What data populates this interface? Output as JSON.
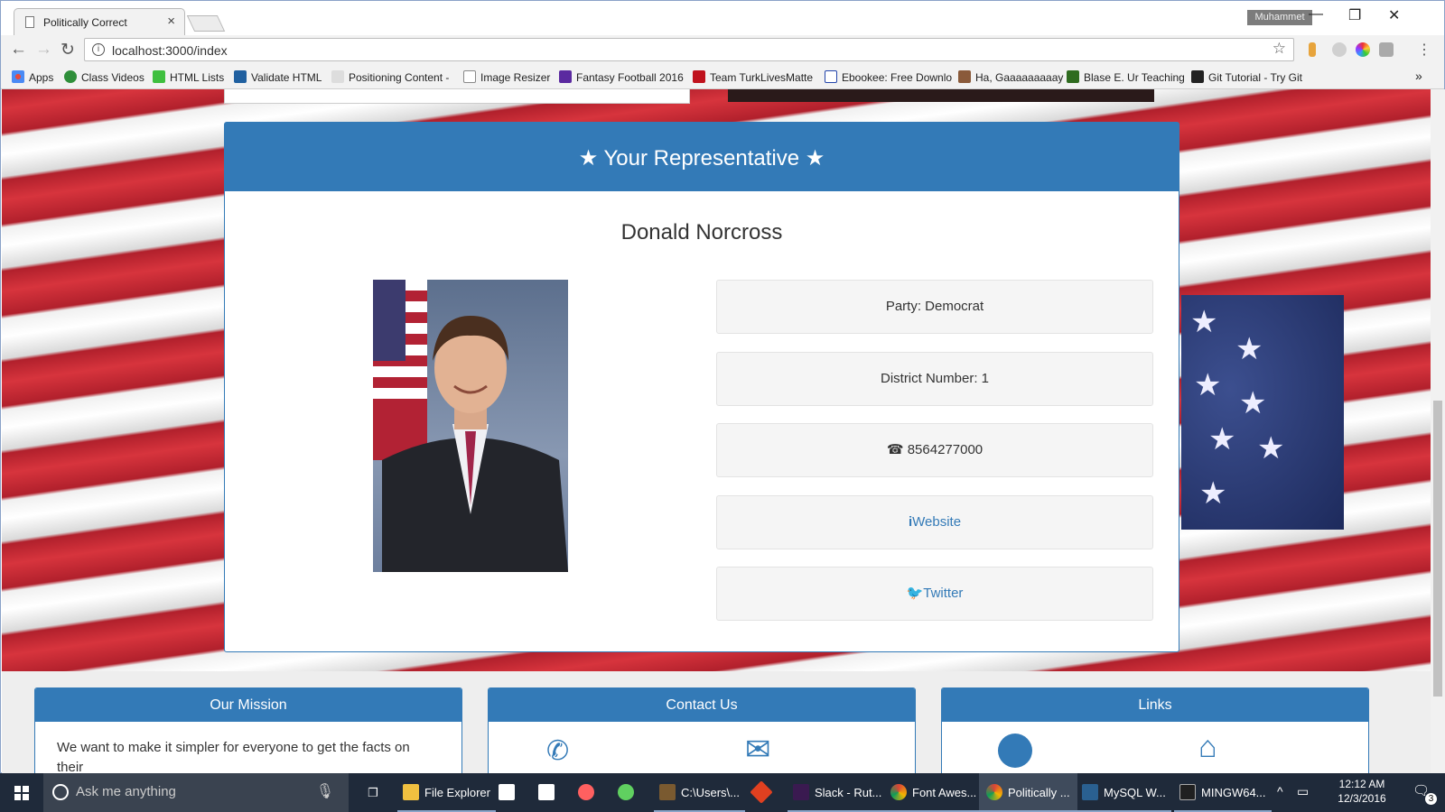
{
  "browser": {
    "tab_title": "Politically Correct",
    "tab_close": "×",
    "profile_name": "Muhammet",
    "url": "localhost:3000/index",
    "window_controls": {
      "minimize": "—",
      "restore": "❐",
      "close": "✕"
    },
    "nav": {
      "back": "←",
      "forward": "→",
      "reload": "↻"
    },
    "bookmarks": [
      {
        "label": "Apps",
        "icon": "apps-grid-icon",
        "color": "#e84a3c"
      },
      {
        "label": "Class Videos",
        "icon": "globe-icon",
        "color": "#2f8f3a"
      },
      {
        "label": "HTML Lists",
        "icon": "html-icon",
        "color": "#3fbf3f"
      },
      {
        "label": "Validate HTML",
        "icon": "w3-icon",
        "color": "#2060a0"
      },
      {
        "label": "Positioning Content -",
        "icon": "code-icon",
        "color": "#444444"
      },
      {
        "label": "Image Resizer",
        "icon": "page-icon",
        "color": "#999999"
      },
      {
        "label": "Fantasy Football 2016",
        "icon": "yahoo-icon",
        "color": "#5b2aa0"
      },
      {
        "label": "Team TurkLivesMatte",
        "icon": "flag-icon",
        "color": "#c0121d"
      },
      {
        "label": "Ebookee: Free Downlo",
        "icon": "b-icon",
        "color": "#2244aa"
      },
      {
        "label": "Ha, Gaaaaaaaaay",
        "icon": "avatar-icon",
        "color": "#8a5a3a"
      },
      {
        "label": "Blase E. Ur Teaching",
        "icon": "blase-icon",
        "color": "#2f6b1f"
      },
      {
        "label": "Git Tutorial - Try Git",
        "icon": "git-icon",
        "color": "#222222"
      }
    ],
    "bookmarks_overflow": "»"
  },
  "page": {
    "rep_heading": "★ Your Representative ★",
    "rep_name": "Donald Norcross",
    "party": "Party: Democrat",
    "district": "District Number: 1",
    "phone_icon": "phone-icon",
    "phone": "8564277000",
    "website_icon": "info-icon",
    "website": "Website",
    "twitter_icon": "twitter-icon",
    "twitter": "Twitter",
    "footer": {
      "mission_title": "Our Mission",
      "mission_text": "We want to make it simpler for everyone to get the facts on their",
      "contact_title": "Contact Us",
      "links_title": "Links"
    }
  },
  "taskbar": {
    "search_placeholder": "Ask me anything",
    "items": [
      {
        "label": "File Explorer",
        "icon": "folder-icon",
        "color": "#f0c040"
      },
      {
        "label": "",
        "icon": "store-icon",
        "color": "#ffffff"
      },
      {
        "label": "",
        "icon": "amazon-icon",
        "color": "#ffffff"
      },
      {
        "label": "",
        "icon": "paint-icon",
        "color": "#ff6060"
      },
      {
        "label": "",
        "icon": "android-icon",
        "color": "#60d060"
      },
      {
        "label": "C:\\Users\\...",
        "icon": "sublime-icon",
        "color": "#7a5a30"
      },
      {
        "label": "",
        "icon": "git-gui-icon",
        "color": "#e04020"
      },
      {
        "label": "Slack - Rut...",
        "icon": "slack-icon",
        "color": "#3a1a50"
      },
      {
        "label": "Font Awes...",
        "icon": "chrome-icon",
        "color": "#e0a020"
      },
      {
        "label": "Politically ...",
        "icon": "chrome-icon",
        "color": "#e0a020"
      },
      {
        "label": "MySQL W...",
        "icon": "mysql-icon",
        "color": "#2a6090"
      },
      {
        "label": "MINGW64...",
        "icon": "terminal-icon",
        "color": "#202020"
      }
    ],
    "time": "12:12 AM",
    "date": "12/3/2016",
    "notifications": "3"
  },
  "colors": {
    "primary": "#337ab7",
    "taskbar": "#1f2a3a"
  }
}
